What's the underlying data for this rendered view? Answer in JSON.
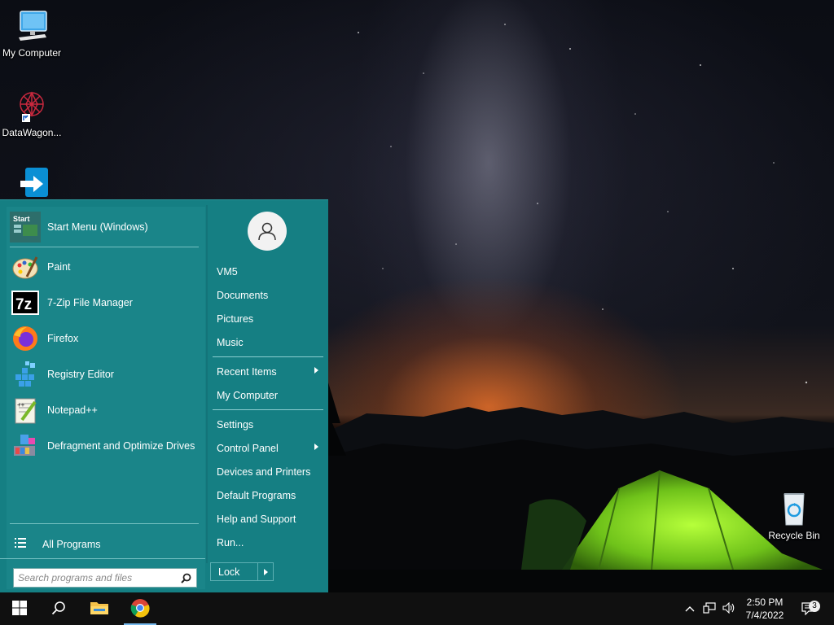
{
  "desktop": {
    "icons": [
      {
        "label": "My Computer",
        "icon": "monitor-icon"
      },
      {
        "label": "DataWagon...",
        "icon": "datawagon-logo-icon"
      },
      {
        "label": "",
        "icon": "arrow-app-icon"
      },
      {
        "label": "Recycle Bin",
        "icon": "recycle-bin-icon"
      }
    ]
  },
  "start_menu": {
    "pinned": {
      "label": "Start Menu (Windows)",
      "icon": "start-menu-icon"
    },
    "programs": [
      {
        "label": "Paint",
        "icon": "paint-palette-icon"
      },
      {
        "label": "7-Zip File Manager",
        "icon": "7zip-icon"
      },
      {
        "label": "Firefox",
        "icon": "firefox-icon"
      },
      {
        "label": "Registry Editor",
        "icon": "registry-editor-icon"
      },
      {
        "label": "Notepad++",
        "icon": "notepad-plus-plus-icon"
      },
      {
        "label": "Defragment and Optimize Drives",
        "icon": "defragment-icon"
      }
    ],
    "all_programs": "All Programs",
    "search": {
      "placeholder": "Search programs and files",
      "value": ""
    },
    "user": {
      "name": "VM5",
      "icon": "user-avatar-icon"
    },
    "right_items": [
      {
        "label": "VM5",
        "submenu": false
      },
      {
        "label": "Documents",
        "submenu": false
      },
      {
        "label": "Pictures",
        "submenu": false
      },
      {
        "label": "Music",
        "submenu": false
      },
      {
        "label": "Recent Items",
        "submenu": true
      },
      {
        "label": "My Computer",
        "submenu": false
      },
      {
        "label": "Settings",
        "submenu": false
      },
      {
        "label": "Control Panel",
        "submenu": true
      },
      {
        "label": "Devices and Printers",
        "submenu": false
      },
      {
        "label": "Default Programs",
        "submenu": false
      },
      {
        "label": "Help and Support",
        "submenu": false
      },
      {
        "label": "Run...",
        "submenu": false
      }
    ],
    "lock_label": "Lock",
    "colors": {
      "panel": "#157f83",
      "left": "#1a8589"
    }
  },
  "taskbar": {
    "buttons": [
      {
        "name": "start-button",
        "icon": "windows-logo-icon"
      },
      {
        "name": "search-button",
        "icon": "search-icon"
      },
      {
        "name": "file-explorer-button",
        "icon": "folder-icon"
      },
      {
        "name": "chrome-button",
        "icon": "chrome-icon"
      }
    ],
    "clock": {
      "time": "2:50 PM",
      "date": "7/4/2022"
    },
    "notifications_count": "3"
  }
}
